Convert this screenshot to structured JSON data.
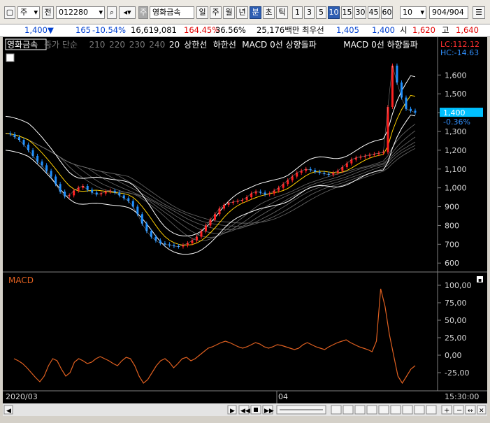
{
  "toolbar": {
    "market_select": "주",
    "prev_label": "전",
    "code_value": "012280",
    "stock_tag": "주",
    "stock_name": "영화금속",
    "period_buttons": [
      "일",
      "주",
      "월",
      "년",
      "분",
      "초",
      "틱"
    ],
    "selected_period": "분",
    "interval_buttons": [
      "1",
      "3",
      "5",
      "10",
      "15",
      "30",
      "45",
      "60"
    ],
    "selected_interval": "10",
    "interval_value": "10",
    "page_counter": "904/904",
    "overflow_label": "▶"
  },
  "quote": {
    "price": "1,400",
    "direction_icon": "down-triangle",
    "change": "165",
    "change_pct": "-10.54%",
    "volume": "16,619,081",
    "volume_ratio": "164.45%",
    "turnover_pct": "36.56%",
    "trade_amount": "25,176백만",
    "ask_label": "최우선",
    "ask_price": "1,405",
    "bid_price": "1,400",
    "open_label": "시",
    "open_price": "1,620",
    "high_label": "고",
    "high_price": "1,640"
  },
  "chart_data": {
    "type": "line",
    "price_panel": {
      "legend": [
        "영화금속",
        "종가 단순",
        "210",
        "220",
        "230",
        "240",
        "20",
        "상한선",
        "하한선",
        "MACD 0선 상향돌파",
        "MACD 0선 하향돌파"
      ],
      "last_price_label": "1,400",
      "last_change_label": "-0.36%",
      "lc_label": "LC:112.12",
      "hc_label": "HC:-14.63",
      "y_ticks": [
        "1,600",
        "1,500",
        "1,400",
        "1,300",
        "1,200",
        "1,100",
        "1,000",
        "900",
        "800",
        "700",
        "600"
      ],
      "ylim": [
        560,
        1720
      ],
      "series": [
        {
          "name": "영화금속",
          "values": [
            1290,
            1285,
            1270,
            1255,
            1230,
            1200,
            1170,
            1140,
            1120,
            1090,
            1060,
            1020,
            980,
            955,
            960,
            985,
            1000,
            1010,
            990,
            975,
            965,
            970,
            980,
            985,
            975,
            960,
            945,
            930,
            900,
            860,
            810,
            770,
            740,
            720,
            705,
            700,
            695,
            690,
            688,
            695,
            705,
            720,
            740,
            770,
            800,
            830,
            860,
            890,
            910,
            920,
            925,
            930,
            935,
            950,
            970,
            980,
            975,
            965,
            970,
            985,
            1000,
            1020,
            1040,
            1060,
            1080,
            1090,
            1100,
            1095,
            1085,
            1080,
            1075,
            1070,
            1080,
            1090,
            1110,
            1130,
            1150,
            1160,
            1165,
            1170,
            1175,
            1180,
            1185,
            1190,
            1430,
            1650,
            1560,
            1480,
            1420,
            1410,
            1400
          ]
        }
      ]
    },
    "macd_panel": {
      "title": "MACD",
      "y_ticks": [
        "100,00",
        "75,00",
        "50,00",
        "25,00",
        "0,00",
        "-25,00"
      ],
      "ylim": [
        -45,
        110
      ],
      "series": [
        {
          "name": "MACD",
          "values": [
            -5,
            -8,
            -12,
            -18,
            -25,
            -32,
            -38,
            -30,
            -15,
            -5,
            -8,
            -20,
            -30,
            -25,
            -10,
            -5,
            -8,
            -12,
            -10,
            -5,
            -2,
            -5,
            -8,
            -12,
            -15,
            -8,
            -3,
            -5,
            -15,
            -30,
            -40,
            -35,
            -25,
            -15,
            -8,
            -5,
            -10,
            -18,
            -12,
            -5,
            -3,
            -8,
            -5,
            0,
            5,
            10,
            12,
            15,
            18,
            20,
            18,
            15,
            12,
            10,
            12,
            15,
            18,
            16,
            12,
            10,
            12,
            15,
            14,
            12,
            10,
            8,
            10,
            15,
            18,
            15,
            12,
            10,
            8,
            12,
            15,
            18,
            20,
            22,
            18,
            15,
            12,
            10,
            8,
            5,
            20,
            95,
            70,
            30,
            0,
            -30,
            -40,
            -30,
            -20,
            -15
          ]
        }
      ]
    },
    "x_labels": [
      "2020/03",
      "04",
      "15:30:00"
    ]
  },
  "colors": {
    "background": "#000000",
    "candle_up": "#ff2020",
    "candle_down": "#1e90ff",
    "macd_line": "#e06020",
    "price_tag": "#00c0ff"
  }
}
